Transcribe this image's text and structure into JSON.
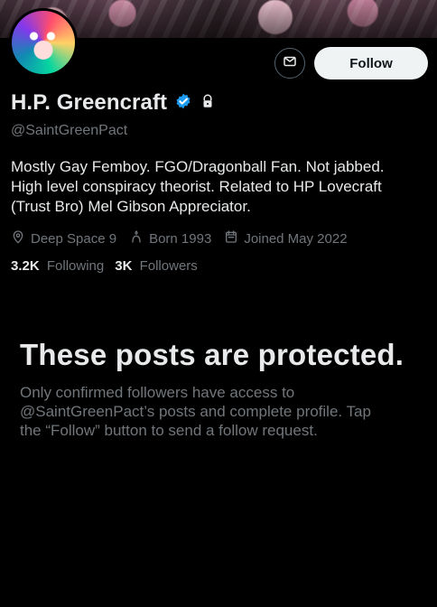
{
  "profile": {
    "display_name": "H.P. Greencraft",
    "handle": "@SaintGreenPact",
    "bio_lines": [
      "Mostly Gay Femboy. FGO/Dragonball Fan. Not jabbed.",
      "High level conspiracy theorist. Related to HP Lovecraft",
      "(Trust Bro) Mel Gibson Appreciator."
    ],
    "meta": {
      "location": "Deep Space 9",
      "born": "Born 1993",
      "joined": "Joined May 2022"
    },
    "counts": {
      "following_value": "3.2K",
      "following_label": "Following",
      "followers_value": "3K",
      "followers_label": "Followers"
    }
  },
  "actions": {
    "follow_label": "Follow"
  },
  "protected": {
    "title": "These posts are protected.",
    "body_lines": [
      "Only confirmed followers have access to",
      "@SaintGreenPact’s posts and complete profile. Tap",
      "the “Follow” button to send a follow request."
    ]
  },
  "icons": {
    "message": "message-icon",
    "verified": "verified-badge-icon",
    "lock": "lock-icon",
    "location": "location-pin-icon",
    "birthday": "birthday-icon",
    "calendar": "calendar-icon"
  },
  "colors": {
    "background": "#000000",
    "primary_text": "#e7e9ea",
    "secondary_text": "#71767b",
    "follow_button_bg": "#eff3f4",
    "verified_blue": "#1d9bf0"
  }
}
